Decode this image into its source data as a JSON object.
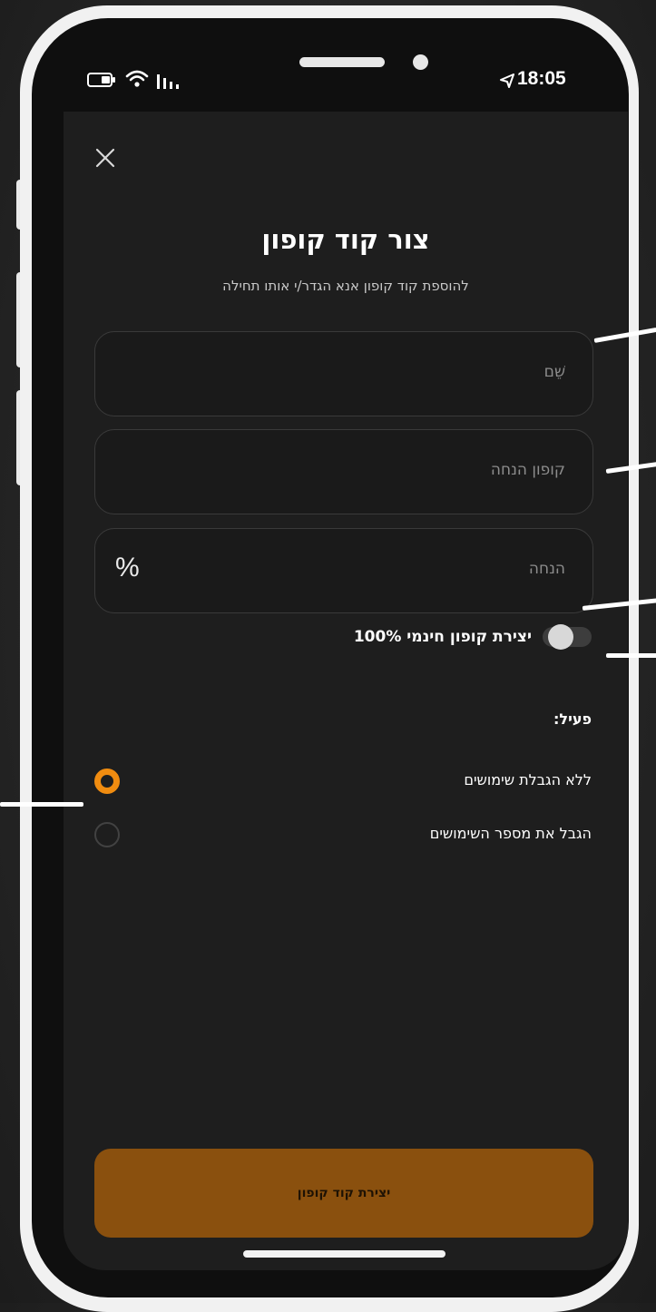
{
  "status_bar": {
    "time": "18:05"
  },
  "form": {
    "title": "צור קוד קופון",
    "subtitle": "להוספת קוד קופון אנא הגדר/י אותו תחילה",
    "name_placeholder": "שֵׁם",
    "code_placeholder": "קופון הנחה",
    "discount_placeholder": "הנחה",
    "discount_unit": "%",
    "free_coupon_label": "יצירת קופון חינמי 100%",
    "free_coupon_enabled": false,
    "active_label": "פעיל:",
    "usage_options": [
      {
        "label": "ללא הגבלת שימושים",
        "selected": true
      },
      {
        "label": "הגבל את מספר השימושים",
        "selected": false
      }
    ],
    "submit_label": "יצירת קוד קופון"
  },
  "colors": {
    "accent": "#f08c10",
    "button": "#8a500e",
    "screen_bg": "#1e1e1e"
  },
  "icons": [
    "close-icon",
    "battery-icon",
    "wifi-icon",
    "signal-icon",
    "location-arrow-icon"
  ]
}
